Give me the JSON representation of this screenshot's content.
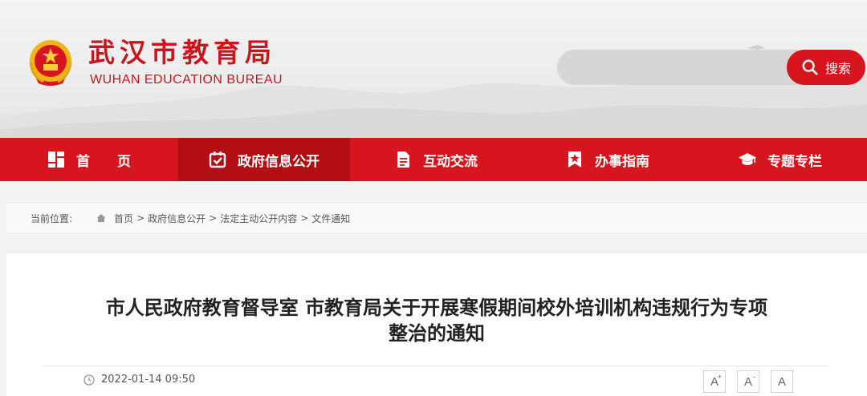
{
  "header": {
    "title_cn": "武汉市教育局",
    "title_en": "WUHAN EDUCATION BUREAU",
    "emblem_icon": "national-emblem",
    "brand_color": "#c8161d"
  },
  "search": {
    "placeholder": "",
    "button_label": "搜索",
    "icon": "search-icon"
  },
  "nav": {
    "items": [
      {
        "label": "首　　页",
        "icon": "grid-icon"
      },
      {
        "label": "政府信息公开",
        "icon": "calendar-check-icon",
        "active": true
      },
      {
        "label": "互动交流",
        "icon": "document-icon"
      },
      {
        "label": "办事指南",
        "icon": "bookmark-star-icon"
      },
      {
        "label": "专题专栏",
        "icon": "graduation-cap-icon"
      }
    ],
    "bg_color": "#d7151e",
    "active_color": "#b20e14"
  },
  "breadcrumb": {
    "lead": "当前位置:",
    "items": [
      "首页",
      "政府信息公开",
      "法定主动公开内容",
      "文件通知"
    ],
    "separator": ">"
  },
  "article": {
    "title_line1": "市人民政府教育督导室 市教育局关于开展寒假期间校外培训机构违规行为专项",
    "title_line2": "整治的通知",
    "date": "2022-01-14 09:50",
    "font_sizes": [
      "A",
      "A",
      "A"
    ],
    "font_size_marks": [
      "+",
      "-",
      ""
    ]
  }
}
